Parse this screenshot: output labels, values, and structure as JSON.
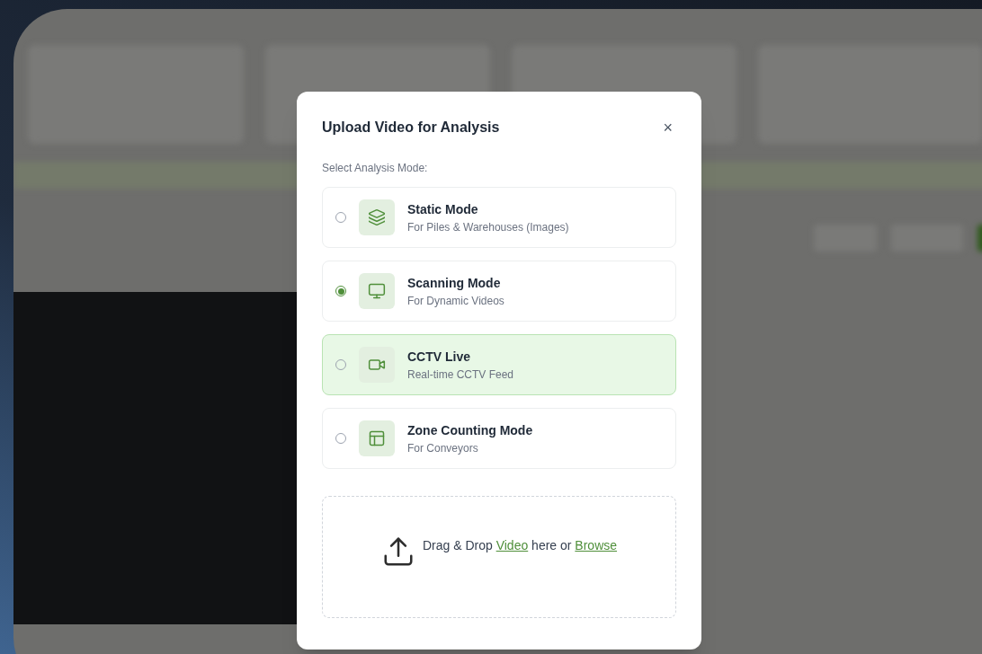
{
  "dialog": {
    "title": "Upload Video for Analysis",
    "close": "×",
    "section_label": "Select Analysis Mode:",
    "modes": [
      {
        "title": "Static Mode",
        "subtitle": "For Piles & Warehouses (Images)",
        "selected": false,
        "highlighted": false
      },
      {
        "title": "Scanning Mode",
        "subtitle": "For Dynamic Videos",
        "selected": true,
        "highlighted": false
      },
      {
        "title": "CCTV Live",
        "subtitle": "Real-time CCTV Feed",
        "selected": false,
        "highlighted": true
      },
      {
        "title": "Zone Counting Mode",
        "subtitle": "For Conveyors",
        "selected": false,
        "highlighted": false
      }
    ],
    "drop_zone": {
      "parts": [
        {
          "kind": "text",
          "text": "Drag & Drop "
        },
        {
          "kind": "link",
          "text": "Video"
        },
        {
          "kind": "text",
          "text": " here or "
        },
        {
          "kind": "link",
          "text": "Browse"
        }
      ]
    }
  }
}
